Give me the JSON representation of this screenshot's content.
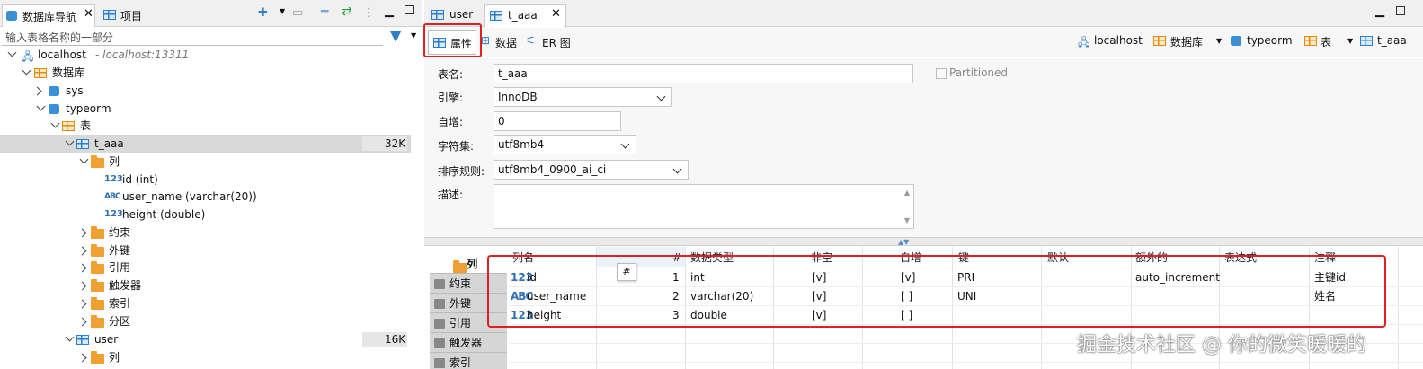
{
  "left_panel": {
    "tabs": [
      {
        "label": "数据库导航"
      },
      {
        "label": "项目"
      }
    ],
    "filter_placeholder": "输入表格名称的一部分",
    "tree": [
      {
        "label": "localhost",
        "suffix": "- localhost:13311"
      },
      {
        "label": "数据库"
      },
      {
        "label": "sys"
      },
      {
        "label": "typeorm"
      },
      {
        "label": "表"
      },
      {
        "label": "t_aaa",
        "size": "32K"
      },
      {
        "label": "列"
      },
      {
        "label": "id (int)",
        "icon": "123"
      },
      {
        "label": "user_name (varchar(20))",
        "icon": "ABC"
      },
      {
        "label": "height (double)",
        "icon": "123"
      },
      {
        "label": "约束"
      },
      {
        "label": "外键"
      },
      {
        "label": "引用"
      },
      {
        "label": "触发器"
      },
      {
        "label": "索引"
      },
      {
        "label": "分区"
      },
      {
        "label": "user",
        "size": "16K"
      },
      {
        "label": "列"
      }
    ]
  },
  "editor": {
    "tabs": [
      {
        "label": "user"
      },
      {
        "label": "t_aaa"
      }
    ],
    "sub_tabs": [
      {
        "label": "属性"
      },
      {
        "label": "数据"
      },
      {
        "label": "ER 图"
      }
    ],
    "breadcrumb": [
      {
        "label": "localhost"
      },
      {
        "label": "数据库"
      },
      {
        "label": "typeorm"
      },
      {
        "label": "表"
      },
      {
        "label": "t_aaa"
      }
    ],
    "properties": {
      "table_name_label": "表名:",
      "table_name_value": "t_aaa",
      "partitioned_label": "Partitioned",
      "engine_label": "引擎:",
      "engine_value": "InnoDB",
      "auto_inc_label": "自增:",
      "auto_inc_value": "0",
      "charset_label": "字符集:",
      "charset_value": "utf8mb4",
      "collation_label": "排序规则:",
      "collation_value": "utf8mb4_0900_ai_ci",
      "description_label": "描述:"
    },
    "side_tabs": [
      {
        "label": "列"
      },
      {
        "label": "约束"
      },
      {
        "label": "外键"
      },
      {
        "label": "引用"
      },
      {
        "label": "触发器"
      },
      {
        "label": "索引"
      }
    ],
    "columns_table": {
      "headers": [
        "列名",
        "#",
        "数据类型",
        "非空",
        "自增",
        "键",
        "默认",
        "额外的",
        "表达式",
        "注释"
      ],
      "hover_tooltip": "#",
      "rows": [
        {
          "icon": "123",
          "name": "id",
          "num": "1",
          "type": "int",
          "not_null": "[v]",
          "auto_inc": "[v]",
          "key": "PRI",
          "default": "",
          "extra": "auto_increment",
          "expr": "",
          "comment": "主键id"
        },
        {
          "icon": "ABC",
          "name": "user_name",
          "num": "2",
          "type": "varchar(20)",
          "not_null": "[v]",
          "auto_inc": "[ ]",
          "key": "UNI",
          "default": "",
          "extra": "",
          "expr": "",
          "comment": "姓名"
        },
        {
          "icon": "123",
          "name": "height",
          "num": "3",
          "type": "double",
          "not_null": "[v]",
          "auto_inc": "[ ]",
          "key": "",
          "default": "",
          "extra": "",
          "expr": "",
          "comment": ""
        }
      ]
    }
  },
  "watermark": "掘金技术社区 @ 你的微笑暖暖的",
  "colors": {
    "highlight_red": "#e02020",
    "selected_row": "#d9d9d9",
    "accent_blue": "#2e7fc7",
    "folder_orange": "#f0a030"
  }
}
